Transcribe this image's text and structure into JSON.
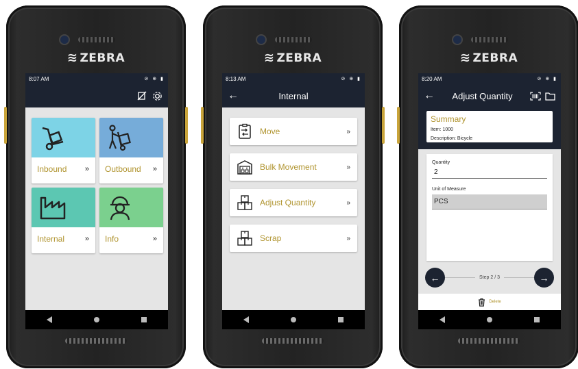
{
  "brand": "ZEBRA",
  "colors": {
    "appbar": "#1c2331",
    "accent": "#b0942f",
    "inbound": "#7dd3e6",
    "outbound": "#76acd9",
    "internal": "#5cc7b2",
    "info": "#7bd08e"
  },
  "phone1": {
    "status": {
      "time": "8:07 AM",
      "icons": "⊘ ⊕ ▮"
    },
    "appbar": {
      "icons": [
        "sync-off-icon",
        "gear-icon"
      ]
    },
    "tiles": [
      {
        "label": "Inbound",
        "chevron": "»",
        "icon": "hand-truck-icon"
      },
      {
        "label": "Outbound",
        "chevron": "»",
        "icon": "worker-cart-icon"
      },
      {
        "label": "Internal",
        "chevron": "»",
        "icon": "factory-icon"
      },
      {
        "label": "Info",
        "chevron": "»",
        "icon": "worker-helmet-icon"
      }
    ]
  },
  "phone2": {
    "status": {
      "time": "8:13 AM",
      "icons": "⊘ ⊕ ▮"
    },
    "appbar": {
      "title": "Internal",
      "back": "←"
    },
    "menu": [
      {
        "label": "Move",
        "chevron": "»",
        "icon": "clipboard-move-icon"
      },
      {
        "label": "Bulk Movement",
        "chevron": "»",
        "icon": "warehouse-icon"
      },
      {
        "label": "Adjust Quantity",
        "chevron": "»",
        "icon": "boxes-icon"
      },
      {
        "label": "Scrap",
        "chevron": "»",
        "icon": "boxes-icon"
      }
    ]
  },
  "phone3": {
    "status": {
      "time": "8:20 AM",
      "icons": "⊘ ⊕ ▮"
    },
    "appbar": {
      "title": "Adjust Quantity",
      "back": "←"
    },
    "summary": {
      "title": "Summary",
      "item": "Item: 1000",
      "description": "Description: Bicycle"
    },
    "form": {
      "quantity_label": "Quantity",
      "quantity_value": "2",
      "uom_label": "Unit of Measure",
      "uom_value": "PCS"
    },
    "stepper": {
      "prev": "←",
      "next": "→",
      "text": "Step  2  /  3"
    },
    "delete_label": "Delete"
  }
}
